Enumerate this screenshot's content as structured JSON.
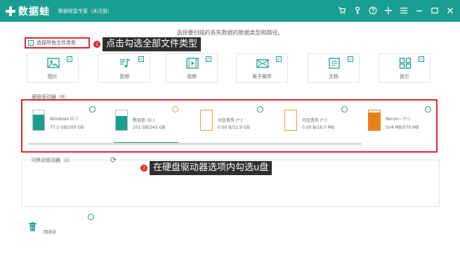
{
  "app": {
    "name": "数据蛙",
    "subtitle": "数据恢复专家（未注册）"
  },
  "titlebar_icons": [
    "cart-icon",
    "key-icon",
    "help-icon",
    "plus-icon",
    "menu-icon",
    "minimize-icon",
    "maximize-icon",
    "close-icon"
  ],
  "hint": "选择要扫描的丢失数据的数据类型和路径。",
  "select_all": {
    "label": "选择所有文件类型",
    "checked": true
  },
  "callouts": [
    {
      "number": "1",
      "text": "点击勾选全部文件类型"
    },
    {
      "number": "2",
      "text": "在硬盘驱动器选项内勾选u盘"
    }
  ],
  "file_types": [
    {
      "label": "图片",
      "icon": "image-icon",
      "checked": true
    },
    {
      "label": "音频",
      "icon": "audio-icon",
      "checked": true
    },
    {
      "label": "视频",
      "icon": "video-icon",
      "checked": true
    },
    {
      "label": "电子邮件",
      "icon": "email-icon",
      "checked": true
    },
    {
      "label": "文档",
      "icon": "document-icon",
      "checked": true
    },
    {
      "label": "其它",
      "icon": "other-icon",
      "checked": true
    }
  ],
  "hdd_section": {
    "label": "硬盘驱动器（6）"
  },
  "drives": [
    {
      "name": "Windows (C:)",
      "size": "77.5 GB/100 GB",
      "used_fraction": 0.78,
      "fill_color": "#1b9e92",
      "selected": false
    },
    {
      "name": "新加卷 (D:)",
      "size": "251 GB/343 GB",
      "used_fraction": 0.73,
      "fill_color": "#1b9e92",
      "selected": false
    },
    {
      "name": "分区丢失 (*:)",
      "size": "0.00  B/31.9 GB",
      "used_fraction": 0,
      "fill_color": "#e8a23b",
      "selected": false
    },
    {
      "name": "分区丢失 (*:)",
      "size": "0.00  B/16.0 MB",
      "used_fraction": 0,
      "fill_color": "#e8a23b",
      "selected": false
    },
    {
      "name": "Recov~ (*:)",
      "size": "504 MB/570 MB",
      "used_fraction": 0.88,
      "fill_color": "#e8801a",
      "selected": false
    }
  ],
  "usb_section": {
    "label": "可移动驱动器（0）"
  },
  "recycle_bin": {
    "label": "回收站",
    "icon": "trash-icon"
  },
  "colors": {
    "accent": "#1b9e92",
    "highlight": "#e0292d",
    "callout_bg": "#2f2f2f"
  }
}
